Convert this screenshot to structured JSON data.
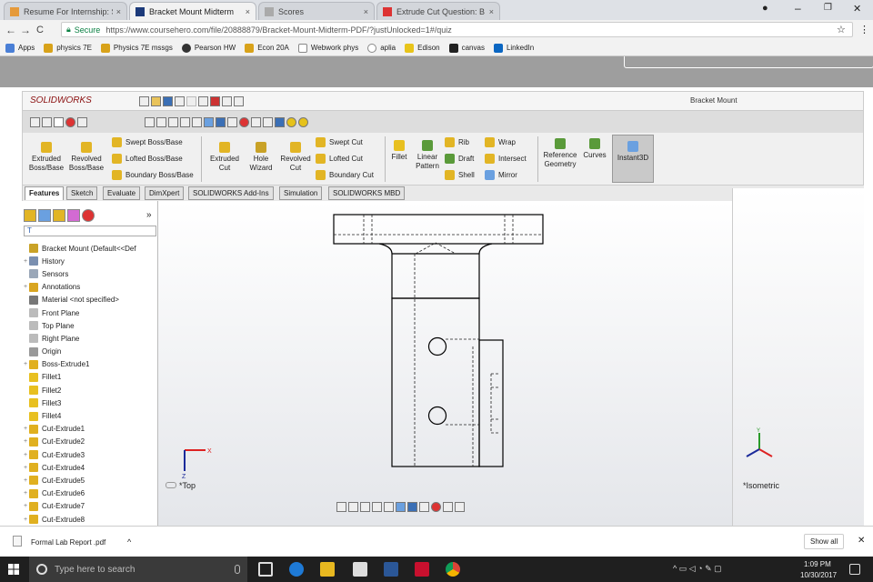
{
  "browser": {
    "tabs": [
      {
        "label": "Resume For Internship: S",
        "active": false
      },
      {
        "label": "Bracket Mount Midterm",
        "active": true
      },
      {
        "label": "Scores",
        "active": false
      },
      {
        "label": "Extrude Cut Question: B",
        "active": false
      }
    ],
    "tab_close": "×",
    "window_controls": {
      "minimize": "–",
      "maximize": "❐",
      "close": "✕",
      "profile": "●"
    },
    "nav": {
      "back": "←",
      "forward": "→",
      "reload": "C"
    },
    "secure_label": "Secure",
    "url": "https://www.coursehero.com/file/20888879/Bracket-Mount-Midterm-PDF/?justUnlocked=1#/quiz",
    "bookmarks": [
      "Apps",
      "physics 7E",
      "Physics 7E mssgs",
      "Pearson HW",
      "Econ 20A",
      "Webwork phys",
      "aplia",
      "Edison",
      "canvas",
      "LinkedIn"
    ]
  },
  "solidworks": {
    "logo": "SOLIDWORKS",
    "doc_title": "Bracket Mount",
    "ribbon": {
      "extruded_boss": "Extruded Boss/Base",
      "revolved_boss": "Revolved Boss/Base",
      "swept_boss": "Swept Boss/Base",
      "lofted_boss": "Lofted Boss/Base",
      "boundary_boss": "Boundary Boss/Base",
      "extruded_cut": "Extruded Cut",
      "hole_wizard": "Hole Wizard",
      "revolved_cut": "Revolved Cut",
      "swept_cut": "Swept Cut",
      "lofted_cut": "Lofted Cut",
      "boundary_cut": "Boundary Cut",
      "fillet": "Fillet",
      "linear_pattern": "Linear Pattern",
      "rib": "Rib",
      "draft": "Draft",
      "shell": "Shell",
      "wrap": "Wrap",
      "intersect": "Intersect",
      "mirror": "Mirror",
      "reference_geometry": "Reference Geometry",
      "curves": "Curves",
      "instant3d": "Instant3D"
    },
    "cm_tabs": [
      "Features",
      "Sketch",
      "Evaluate",
      "DimXpert",
      "SOLIDWORKS Add-Ins",
      "Simulation",
      "SOLIDWORKS MBD"
    ],
    "fm_collapse": "»",
    "filter_glyph": "T",
    "tree": [
      {
        "label": "Bracket Mount  (Default<<Def",
        "color": "#c9a227",
        "exp": ""
      },
      {
        "label": "History",
        "color": "#7a8fb0",
        "exp": "+"
      },
      {
        "label": "Sensors",
        "color": "#9aa7b8",
        "exp": ""
      },
      {
        "label": "Annotations",
        "color": "#d9a520",
        "exp": "+"
      },
      {
        "label": "Material <not specified>",
        "color": "#777777",
        "exp": ""
      },
      {
        "label": "Front Plane",
        "color": "#bbbbbb",
        "exp": ""
      },
      {
        "label": "Top Plane",
        "color": "#bbbbbb",
        "exp": ""
      },
      {
        "label": "Right Plane",
        "color": "#bbbbbb",
        "exp": ""
      },
      {
        "label": "Origin",
        "color": "#999999",
        "exp": ""
      },
      {
        "label": "Boss-Extrude1",
        "color": "#e0b020",
        "exp": "+"
      },
      {
        "label": "Fillet1",
        "color": "#e8c020",
        "exp": ""
      },
      {
        "label": "Fillet2",
        "color": "#e8c020",
        "exp": ""
      },
      {
        "label": "Fillet3",
        "color": "#e8c020",
        "exp": ""
      },
      {
        "label": "Fillet4",
        "color": "#e8c020",
        "exp": ""
      },
      {
        "label": "Cut-Extrude1",
        "color": "#e0b020",
        "exp": "+"
      },
      {
        "label": "Cut-Extrude2",
        "color": "#e0b020",
        "exp": "+"
      },
      {
        "label": "Cut-Extrude3",
        "color": "#e0b020",
        "exp": "+"
      },
      {
        "label": "Cut-Extrude4",
        "color": "#e0b020",
        "exp": "+"
      },
      {
        "label": "Cut-Extrude5",
        "color": "#e0b020",
        "exp": "+"
      },
      {
        "label": "Cut-Extrude6",
        "color": "#e0b020",
        "exp": "+"
      },
      {
        "label": "Cut-Extrude7",
        "color": "#e0b020",
        "exp": "+"
      },
      {
        "label": "Cut-Extrude8",
        "color": "#e0b020",
        "exp": "+"
      }
    ],
    "view_top_label": "*Top",
    "view_iso_label": "*Isometric",
    "axes": {
      "x": "X",
      "y": "Y",
      "z": "Z"
    }
  },
  "download": {
    "file": "Formal Lab Report .pdf",
    "chevron": "^",
    "show_all": "Show all",
    "close": "✕"
  },
  "taskbar": {
    "search_placeholder": "Type here to search",
    "time": "1:09 PM",
    "date": "10/30/2017"
  }
}
